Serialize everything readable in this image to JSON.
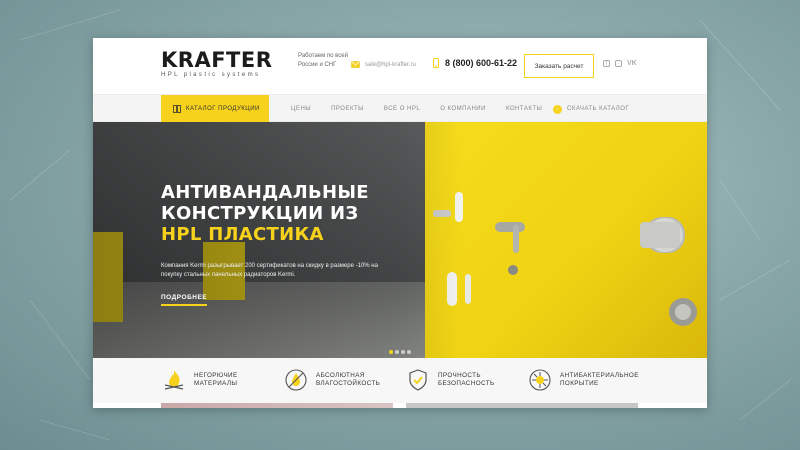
{
  "header": {
    "logo_main": "KRAFTER",
    "logo_sub": "HPL plastic systems",
    "region_text": "Работаем по всей России и СНГ",
    "email": "sale@hpl-krafter.ru",
    "phone": "8 (800) 600-61-22",
    "order_button": "Заказать расчет",
    "socials": [
      "facebook-icon",
      "instagram-icon",
      "vk-icon"
    ],
    "vk_label": "VK"
  },
  "nav": {
    "catalog_label": "КАТАЛОГ ПРОДУКЦИИ",
    "items": [
      "ЦЕНЫ",
      "ПРОЕКТЫ",
      "ВСЕ О HPL",
      "О КОМПАНИИ",
      "КОНТАКТЫ"
    ],
    "download_label": "СКАЧАТЬ КАТАЛОГ"
  },
  "hero": {
    "title_line1": "АНТИВАНДАЛЬНЫЕ",
    "title_line2": "КОНСТРУКЦИИ ИЗ",
    "title_line3": "HPL ПЛАСТИКА",
    "description": "Компания Kermi разыгрывает 200 сертификатов на скидку в размере -10% на покупку стальных панельных радиаторов Kermi.",
    "more_link": "ПОДРОБНЕЕ",
    "slide_current": 1,
    "slide_total": 4
  },
  "features": [
    {
      "icon": "fire-icon",
      "line1": "НЕГОРЮЧИЕ",
      "line2": "МАТЕРИАЛЫ"
    },
    {
      "icon": "water-drop-icon",
      "line1": "АБСОЛЮТНАЯ",
      "line2": "ВЛАГОСТОЙКОСТЬ"
    },
    {
      "icon": "shield-check-icon",
      "line1": "ПРОЧНОСТЬ",
      "line2": "БЕЗОПАСНОСТЬ"
    },
    {
      "icon": "antibacterial-icon",
      "line1": "АНТИБАКТЕРИАЛЬНОЕ",
      "line2": "ПОКРЫТИЕ"
    }
  ],
  "colors": {
    "accent": "#f6d21c",
    "dark_text": "#1c1c1c",
    "nav_bg": "#f4f4f4"
  }
}
